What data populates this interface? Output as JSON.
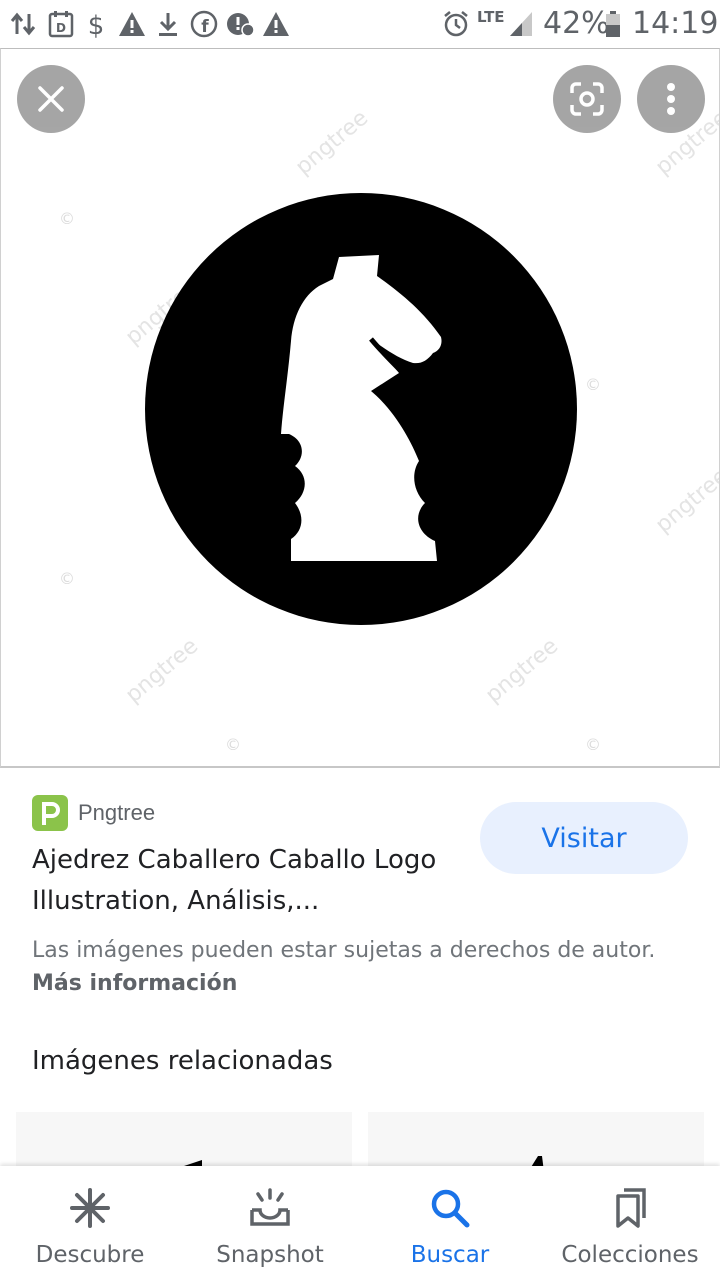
{
  "status_bar": {
    "battery": "42%",
    "time": "14:19",
    "network": "LTE",
    "icons": [
      "data-transfer-icon",
      "calendar-icon",
      "dollar-icon",
      "warning-icon",
      "download-icon",
      "facebook-icon",
      "blocked-cloud-icon",
      "warning-icon",
      "alarm-icon",
      "signal-icon",
      "battery-icon"
    ]
  },
  "viewer": {
    "watermark": "pngtree",
    "copyright_symbol": "©",
    "buttons": {
      "close_icon": "close-icon",
      "lens_icon": "google-lens-icon",
      "more_icon": "more-vert-icon"
    }
  },
  "result": {
    "source_name": "Pngtree",
    "source_icon_letter": "p",
    "title": "Ajedrez Caballero Caballo Logo Illustration, Análisis,...",
    "visit_label": "Visitar",
    "copyright_text": "Las imágenes pueden estar sujetas a derechos de autor.",
    "more_info_label": "Más información"
  },
  "related": {
    "heading": "Imágenes relacionadas"
  },
  "bottom_nav": {
    "items": [
      {
        "label": "Descubre",
        "icon": "discover-asterisk-icon"
      },
      {
        "label": "Snapshot",
        "icon": "snapshot-icon"
      },
      {
        "label": "Buscar",
        "icon": "search-icon"
      },
      {
        "label": "Colecciones",
        "icon": "collections-bookmark-icon"
      }
    ],
    "active_index": 2
  },
  "colors": {
    "accent": "#1a73e8",
    "visit_bg": "#e8f0fe",
    "source_icon_bg": "#8bc34a",
    "text_primary": "#202124",
    "text_secondary": "#5f6368"
  }
}
